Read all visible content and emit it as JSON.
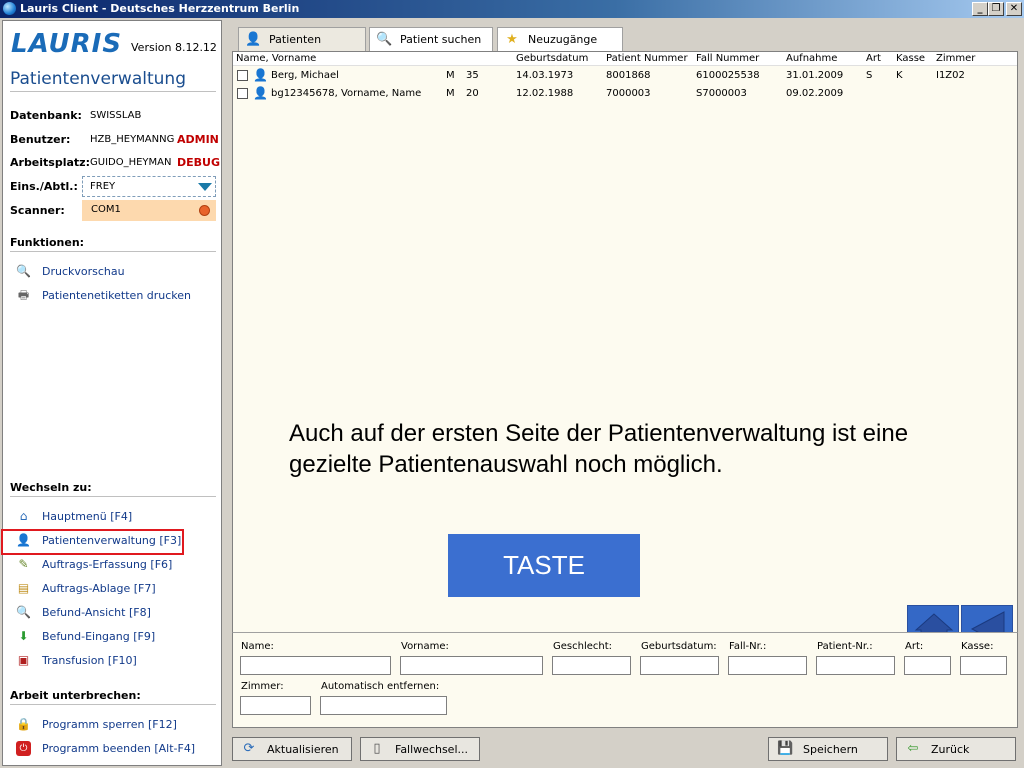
{
  "window": {
    "title": "Lauris Client - Deutsches Herzzentrum Berlin",
    "min_label": "_",
    "max_label": "❐",
    "close_label": "✕"
  },
  "sidebar": {
    "logo": "LAURIS",
    "version": "Version 8.12.12",
    "app_title": "Patientenverwaltung",
    "info": {
      "datenbank_label": "Datenbank:",
      "datenbank_value": "SWISSLAB",
      "benutzer_label": "Benutzer:",
      "benutzer_value": "HZB_HEYMANNG",
      "benutzer_role": "ADMIN",
      "arbeitsplatz_label": "Arbeitsplatz:",
      "arbeitsplatz_value": "GUIDO_HEYMAN",
      "arbeitsplatz_mode": "DEBUG",
      "eins_label": "Eins./Abtl.:",
      "eins_value": "FREY",
      "scanner_label": "Scanner:",
      "scanner_value": "COM1"
    },
    "funktionen_title": "Funktionen:",
    "funktionen": [
      {
        "label": "Druckvorschau",
        "icon": "print-preview-icon"
      },
      {
        "label": "Patientenetiketten drucken",
        "icon": "printer-icon"
      }
    ],
    "wechseln_title": "Wechseln zu:",
    "wechseln": [
      {
        "label": "Hauptmenü [F4]",
        "icon": "home-icon"
      },
      {
        "label": "Patientenverwaltung [F3]",
        "icon": "person-icon"
      },
      {
        "label": "Auftrags-Erfassung [F6]",
        "icon": "edit-icon"
      },
      {
        "label": "Auftrags-Ablage [F7]",
        "icon": "tray-icon"
      },
      {
        "label": "Befund-Ansicht [F8]",
        "icon": "magnifier-icon"
      },
      {
        "label": "Befund-Eingang [F9]",
        "icon": "download-icon"
      },
      {
        "label": "Transfusion [F10]",
        "icon": "transfusion-icon"
      }
    ],
    "arbeit_title": "Arbeit unterbrechen:",
    "arbeit": [
      {
        "label": "Programm sperren [F12]",
        "icon": "lock-icon"
      },
      {
        "label": "Programm beenden [Alt-F4]",
        "icon": "power-icon"
      }
    ]
  },
  "tabs": [
    {
      "label": "Patienten",
      "icon": "person-icon"
    },
    {
      "label": "Patient suchen",
      "icon": "search-icon"
    },
    {
      "label": "Neuzugänge",
      "icon": "star-icon"
    }
  ],
  "table": {
    "headers": [
      "Name,  Vorname",
      "Geburtsdatum",
      "Patient Nummer",
      "Fall Nummer",
      "Aufnahme",
      "Art",
      "Kasse",
      "Zimmer"
    ],
    "rows": [
      {
        "name": "Berg,  Michael",
        "sex": "M",
        "age": "35",
        "birth": "14.03.1973",
        "patnr": "8001868",
        "fallnr": "6100025538",
        "aufnahme": "31.01.2009",
        "art": "S",
        "kasse": "K",
        "zimmer": "I1Z02"
      },
      {
        "name": "bg12345678,  Vorname, Name",
        "sex": "M",
        "age": "20",
        "birth": "12.02.1988",
        "patnr": "7000003",
        "fallnr": "S7000003",
        "aufnahme": "09.02.2009",
        "art": "",
        "kasse": "",
        "zimmer": ""
      }
    ]
  },
  "overlay": {
    "text": "Auch auf der ersten Seite der Patientenverwaltung ist eine gezielte Patientenauswahl noch möglich.",
    "taste_label": "TASTE"
  },
  "search": {
    "name": "Name:",
    "vorname": "Vorname:",
    "geschlecht": "Geschlecht:",
    "geburtsdatum": "Geburtsdatum:",
    "fallnr": "Fall-Nr.:",
    "patientnr": "Patient-Nr.:",
    "art": "Art:",
    "kasse": "Kasse:",
    "zimmer": "Zimmer:",
    "auto": "Automatisch entfernen:"
  },
  "buttons": {
    "aktualisieren": "Aktualisieren",
    "fallwechsel": "Fallwechsel...",
    "speichern": "Speichern",
    "zurueck": "Zurück"
  },
  "colors": {
    "accent_blue": "#3b6fd0",
    "highlight_red": "#e0191f",
    "role_red": "#c00000"
  }
}
